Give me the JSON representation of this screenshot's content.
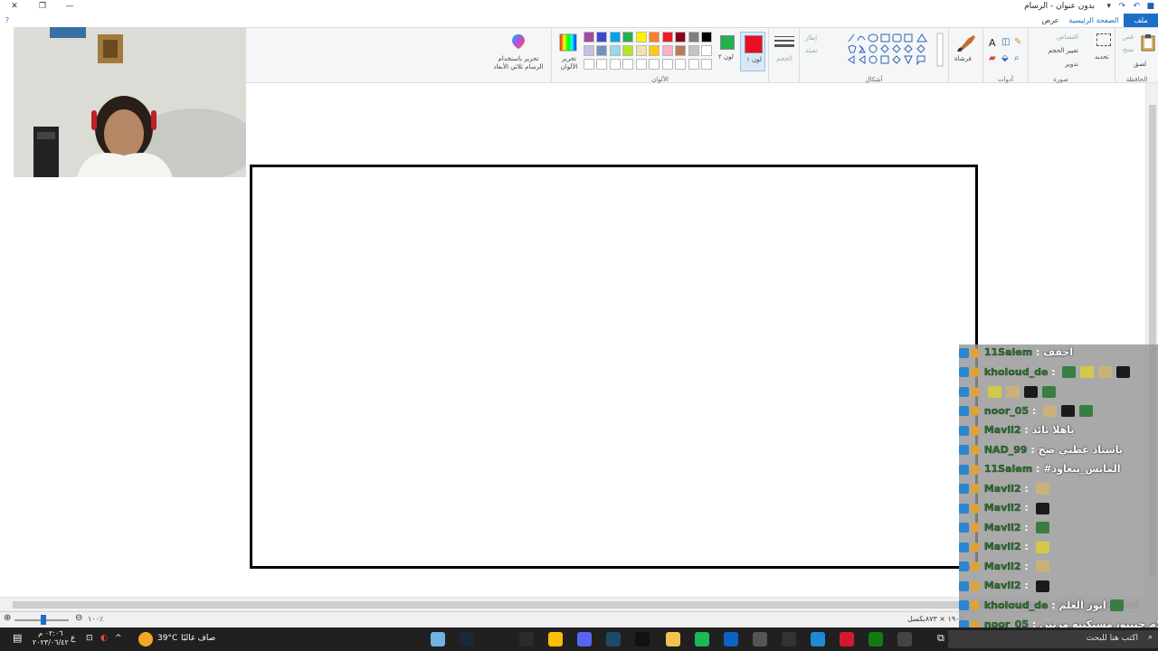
{
  "window": {
    "title": "بدون عنوان - الرسام",
    "minimize_glyph": "—",
    "restore_glyph": "❐",
    "close_glyph": "✕",
    "help_glyph": "?"
  },
  "tabs": [
    {
      "label": "ملف"
    },
    {
      "label": "الصفحة الرئيسية"
    },
    {
      "label": "عرض"
    }
  ],
  "ribbon": {
    "clipboard": {
      "group_label": "الحافظة",
      "paste": "لصق",
      "cut": "قص",
      "copy": "نسخ"
    },
    "image": {
      "group_label": "صورة",
      "select": "تحديد",
      "crop": "اقتصاص",
      "resize": "تغيير الحجم",
      "rotate": "تدوير"
    },
    "tools": {
      "group_label": "أدوات"
    },
    "brushes": {
      "label": "فرشاة"
    },
    "shapes": {
      "group_label": "أشكال",
      "outline": "إطار",
      "fill": "تعبئة"
    },
    "size": {
      "label": "الحجم"
    },
    "colors": {
      "group_label": "الألوان",
      "color1_label": "لون ١",
      "color2_label": "لون ٢",
      "color1": "#e81123",
      "color2": "#22b14c",
      "edit_colors": "تحرير الألوان",
      "paint3d": "تحرير باستخدام الرسام ثلاثي الأبعاد",
      "palette_row1": [
        "#000000",
        "#7f7f7f",
        "#880015",
        "#ed1c24",
        "#ff7f27",
        "#fff200",
        "#22b14c",
        "#00a2e8",
        "#3f48cc",
        "#a349a4"
      ],
      "palette_row2": [
        "#ffffff",
        "#c3c3c3",
        "#b97a57",
        "#ffaec9",
        "#ffc90e",
        "#efe4b0",
        "#b5e61d",
        "#99d9ea",
        "#7092be",
        "#c8bfe7"
      ]
    }
  },
  "statusbar": {
    "dimensions": "١٩٠٦ × ٨٧٣بكسل",
    "zoom": "١٠٠٪"
  },
  "chat": {
    "messages": [
      {
        "user": "11Salem",
        "text": "احقف",
        "emotes": 0
      },
      {
        "user": "kholoud_de",
        "text": "",
        "emotes": 4
      },
      {
        "user": "",
        "text": "",
        "emotes": 4
      },
      {
        "user": "noor_05",
        "text": "",
        "emotes": 3
      },
      {
        "user": "Mavii2",
        "text": "ياهلا ثائد",
        "emotes": 0
      },
      {
        "user": "NAD_99",
        "text": "ياستاذ عطني صح",
        "emotes": 0
      },
      {
        "user": "11Salem",
        "text": "#الماتش_يتعاود",
        "emotes": 0
      },
      {
        "user": "Mavii2",
        "text": "",
        "emotes": 1
      },
      {
        "user": "Mavii2",
        "text": "",
        "emotes": 1
      },
      {
        "user": "Mavii2",
        "text": "",
        "emotes": 1
      },
      {
        "user": "Mavii2",
        "text": "",
        "emotes": 1
      },
      {
        "user": "Mavii2",
        "text": "",
        "emotes": 1
      },
      {
        "user": "Mavii2",
        "text": "",
        "emotes": 1
      },
      {
        "user": "kholoud_de",
        "text": "ابور العلم",
        "emotes": 1
      },
      {
        "user": "noor_05",
        "text": "وعليكم السلام حبيبو، مستكينه مرتين",
        "emotes": 0
      }
    ]
  },
  "taskbar": {
    "search_placeholder": "اكتب هنا للبحث",
    "weather_temp": "39°C",
    "weather_text": "صاف غالبًا",
    "time": "٠٢:٠٦ م",
    "date": "٢٠٢٣/٠٦/٤٢",
    "lang": "ع"
  }
}
